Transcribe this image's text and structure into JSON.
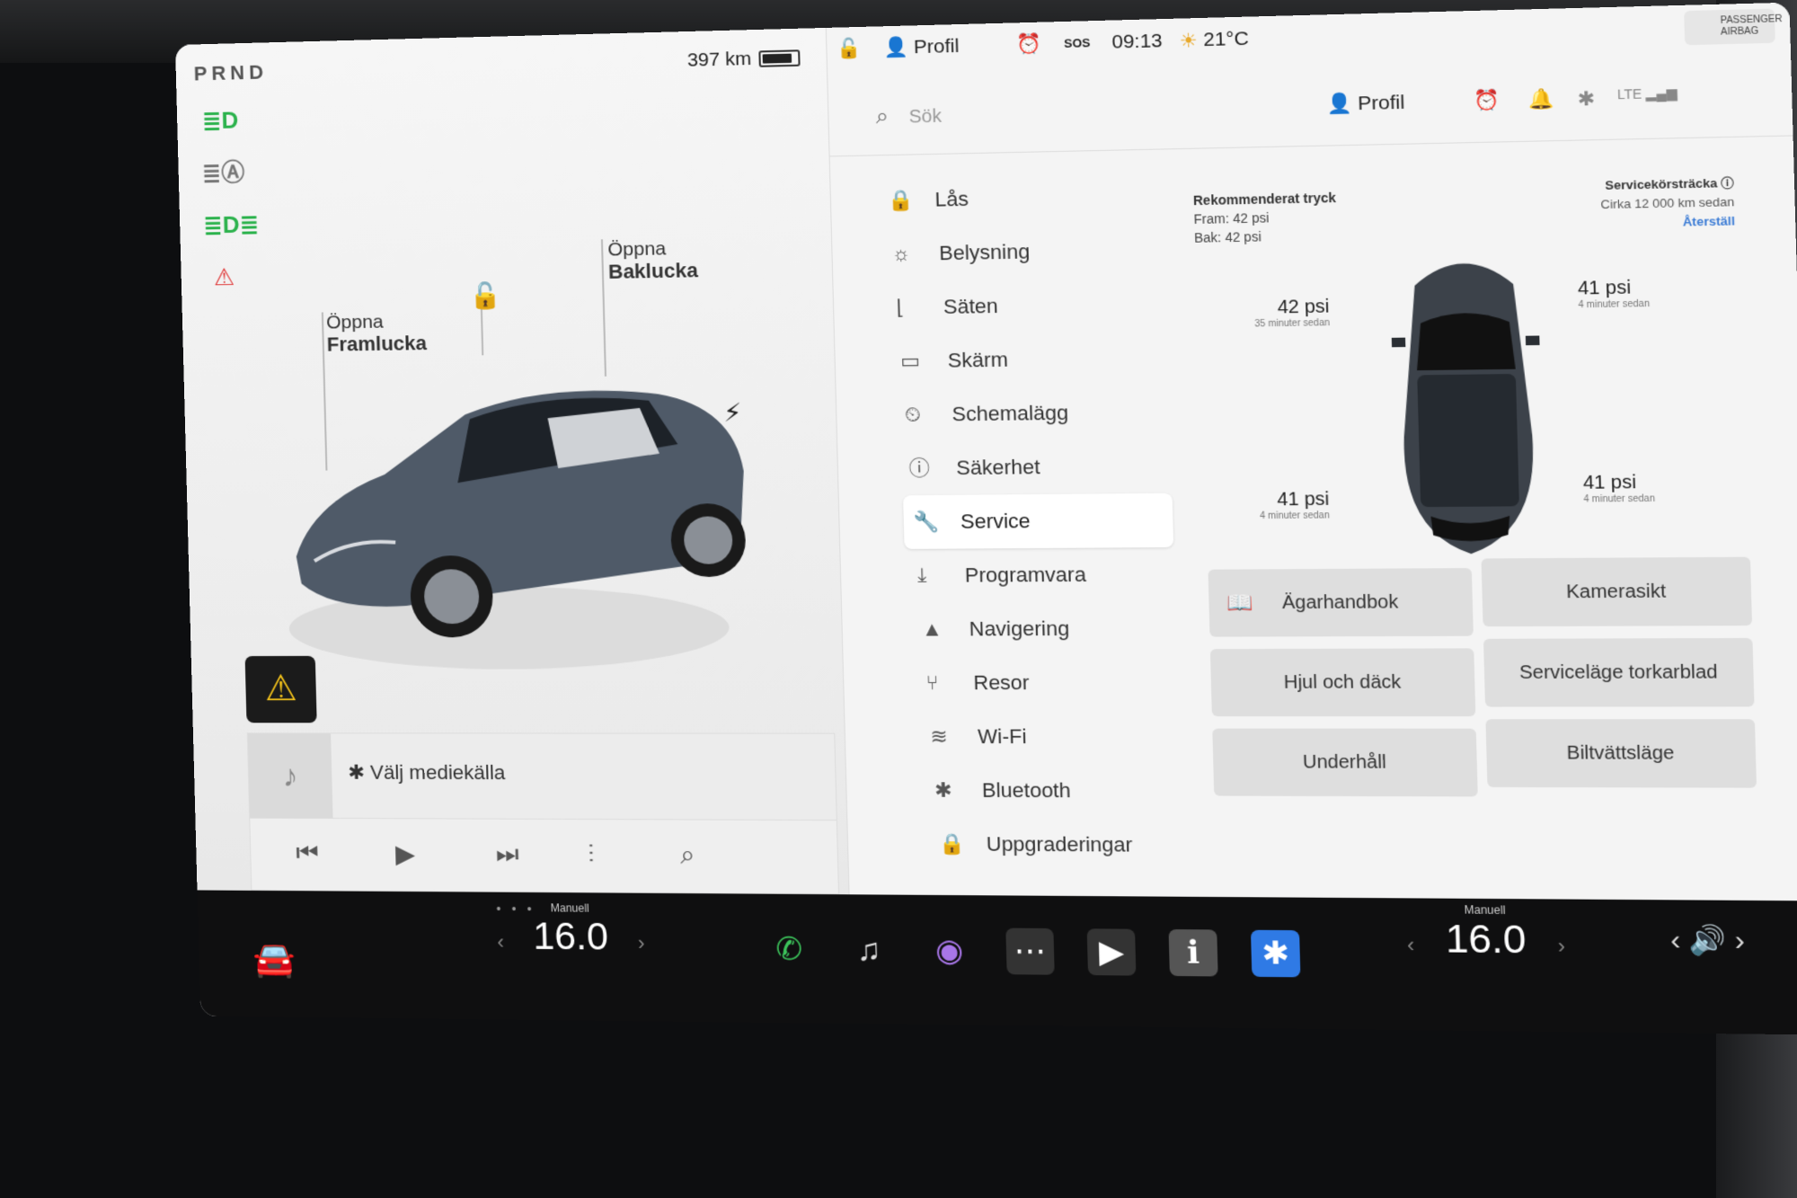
{
  "drive": {
    "gear": "PRND",
    "range": "397 km",
    "battery_level": 0.85
  },
  "left_status_icons": [
    "headlight-icon",
    "auto-headlight-icon",
    "fog-light-icon",
    "seatbelt-warning-icon"
  ],
  "car_view": {
    "frunk_label_1": "Öppna",
    "frunk_label_2": "Framlucka",
    "trunk_label_1": "Öppna",
    "trunk_label_2": "Baklucka"
  },
  "media": {
    "source": "Välj mediekälla"
  },
  "top_bar": {
    "profile": "Profil",
    "sos": "SOS",
    "time": "09:13",
    "temperature": "21°C",
    "airbag_text_1": "PASSENGER",
    "airbag_text_2": "AIRBAG"
  },
  "search": {
    "placeholder": "Sök",
    "profile": "Profil"
  },
  "menu": {
    "items": [
      {
        "label": "Lås",
        "icon": "lock-icon"
      },
      {
        "label": "Belysning",
        "icon": "light-icon"
      },
      {
        "label": "Säten",
        "icon": "seat-icon"
      },
      {
        "label": "Skärm",
        "icon": "display-icon"
      },
      {
        "label": "Schemalägg",
        "icon": "schedule-icon"
      },
      {
        "label": "Säkerhet",
        "icon": "safety-icon"
      },
      {
        "label": "Service",
        "icon": "wrench-icon"
      },
      {
        "label": "Programvara",
        "icon": "download-icon"
      },
      {
        "label": "Navigering",
        "icon": "navigation-icon"
      },
      {
        "label": "Resor",
        "icon": "trips-icon"
      },
      {
        "label": "Wi-Fi",
        "icon": "wifi-icon"
      },
      {
        "label": "Bluetooth",
        "icon": "bluetooth-icon"
      },
      {
        "label": "Uppgraderingar",
        "icon": "upgrades-icon"
      }
    ],
    "active": "Service"
  },
  "service": {
    "recommended_title": "Rekommenderat tryck",
    "front": "Fram: 42 psi",
    "rear": "Bak: 42 psi",
    "mileage_title": "Servicekörsträcka",
    "mileage_value": "Cirka 12 000 km sedan",
    "reset": "Återställ",
    "tyres": {
      "front_left": {
        "value": "42 psi",
        "ago": "35 minuter sedan"
      },
      "front_right": {
        "value": "41 psi",
        "ago": "4 minuter sedan"
      },
      "rear_left": {
        "value": "41 psi",
        "ago": "4 minuter sedan"
      },
      "rear_right": {
        "value": "41 psi",
        "ago": "4 minuter sedan"
      }
    },
    "buttons": {
      "owners_manual": "Ägarhandbok",
      "camera_view": "Kamerasikt",
      "wheels_tyres": "Hjul och däck",
      "wiper_service": "Serviceläge torkarblad",
      "maintenance": "Underhåll",
      "car_wash": "Biltvättsläge"
    }
  },
  "climate": {
    "driver_mode": "Manuell",
    "driver_temp": "16.0",
    "passenger_mode": "Manuell",
    "passenger_temp": "16.0"
  },
  "dock": [
    "phone-icon",
    "music-icon",
    "camera-icon",
    "more-icon",
    "theater-icon",
    "manual-icon",
    "bluetooth-icon"
  ]
}
